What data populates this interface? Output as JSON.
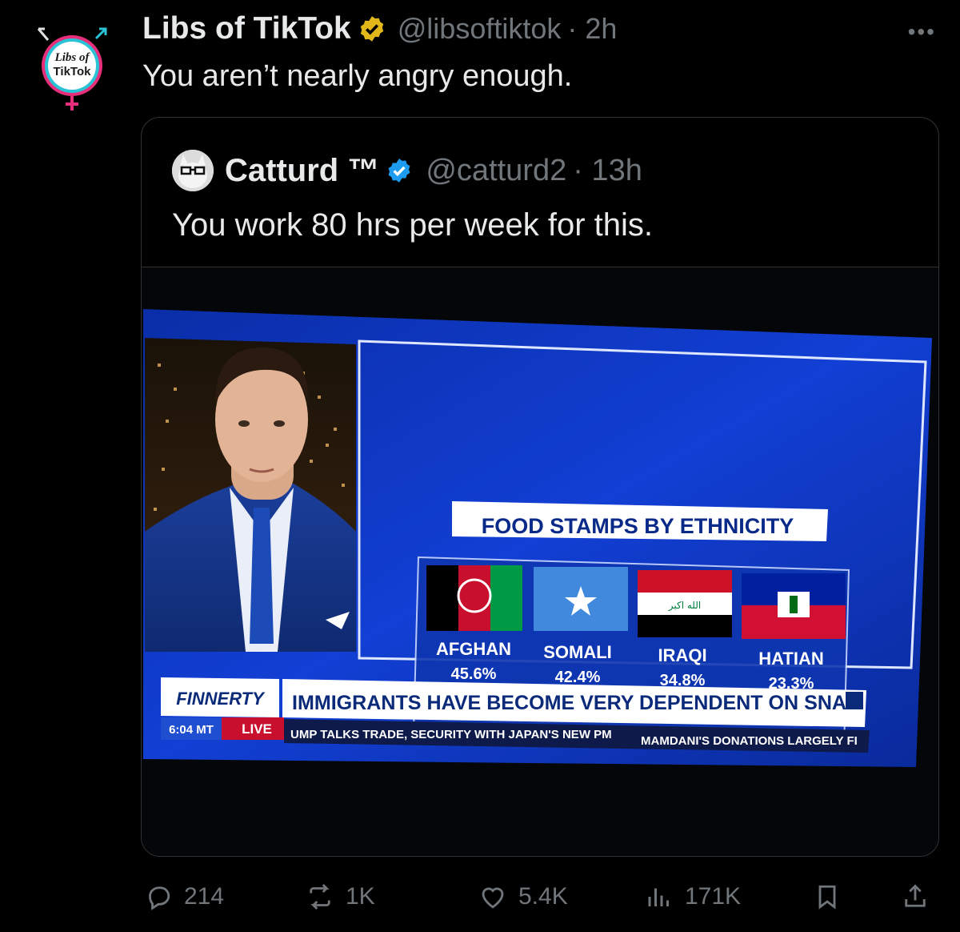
{
  "tweet": {
    "author_name": "Libs of TikTok",
    "author_handle": "@libsoftiktok",
    "time": "· 2h",
    "text": "You aren’t nearly angry enough.",
    "avatar_text_1": "Libs of",
    "avatar_text_2": "TikTok",
    "more_label": "•••",
    "verified_color": "#e2b719"
  },
  "quote": {
    "author_name": "Catturd ™",
    "author_handle": "@catturd2",
    "time": "· 13h",
    "text": "You work 80 hrs per week for this.",
    "verified_color": "#1d9bf0"
  },
  "tv": {
    "graphic_title": "FOOD STAMPS BY ETHNICITY",
    "items": [
      {
        "label": "AFGHAN",
        "value": "45.6%"
      },
      {
        "label": "SOMALI",
        "value": "42.4%"
      },
      {
        "label": "IRAQI",
        "value": "34.8%"
      },
      {
        "label": "HATIAN",
        "value": "23.3%"
      }
    ],
    "show_name": "FINNERTY",
    "headline": "IMMIGRANTS HAVE BECOME VERY DEPENDENT ON SNAI",
    "time": "6:04 MT",
    "live": "LIVE",
    "ticker_1": "UMP TALKS TRADE, SECURITY WITH JAPAN'S NEW PM",
    "ticker_2": "MAMDANI'S DONATIONS LARGELY FI",
    "iraq_script": "الله اكبر"
  },
  "actions": {
    "replies": "214",
    "reposts": "1K",
    "likes": "5.4K",
    "views": "171K"
  }
}
